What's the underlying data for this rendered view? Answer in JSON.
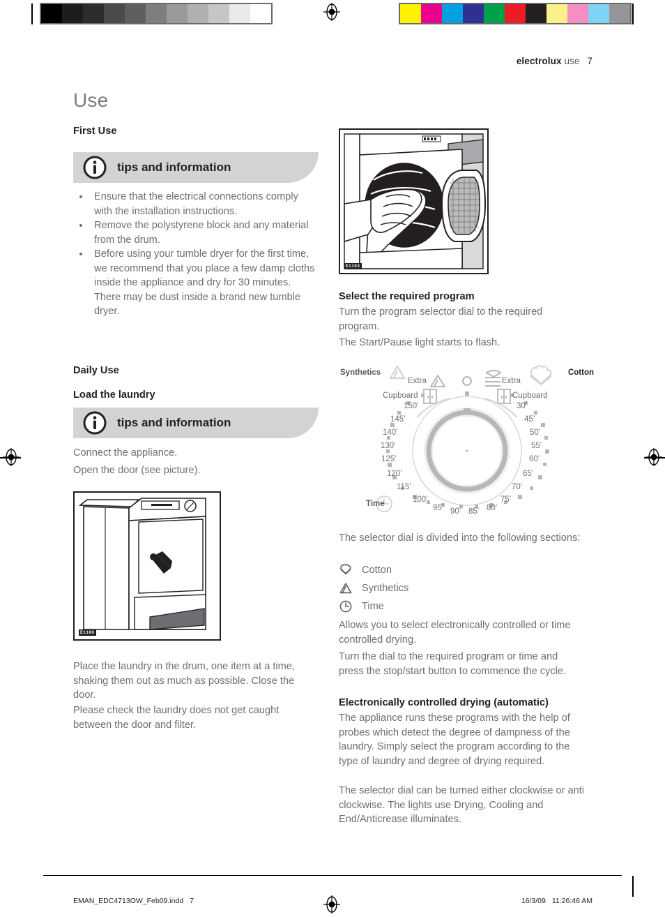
{
  "header": {
    "brand": "electrolux",
    "section": "use",
    "page_number": "7"
  },
  "page_title": "Use",
  "left_column": {
    "first_use_heading": "First Use",
    "tips_banner_label": "tips and information",
    "bullets": [
      "Ensure that the electrical connections comply with the installation instructions.",
      "Remove the polystyrene block and any material from the drum.",
      "Before using your tumble dryer for the first time, we recommend that you place a few damp cloths inside the appliance and dry for 30 minutes."
    ],
    "bullet_continuation": "There may be dust inside a brand new tumble dryer.",
    "daily_use_heading": "Daily Use",
    "load_laundry_heading": "Load the laundry",
    "tips_banner_label_2": "tips and information",
    "connect_line": "Connect the appliance.",
    "open_door_line": "Open the door (see picture).",
    "figure_code": "E1186",
    "closing_paragraph_1": "Place the laundry in the drum, one item at a time, shaking them out as much as possible. Close the door.",
    "closing_paragraph_2": "Please check the laundry does not get caught between the door and filter."
  },
  "right_column": {
    "figure_code": "E1103",
    "select_program_heading": "Select the required program",
    "select_program_line_1": "Turn the program selector dial to the required program.",
    "select_program_line_2": "The Start/Pause light starts to flash.",
    "dial_intro": "The selector dial is divided into the following sections:",
    "legend": [
      {
        "icon": "cotton-icon",
        "label": "Cotton"
      },
      {
        "icon": "synthetics-triangle-icon",
        "label": "Synthetics"
      },
      {
        "icon": "time-clock-icon",
        "label": "Time"
      }
    ],
    "allows_paragraph": "Allows you to select electronically controlled or time controlled drying.",
    "turn_dial_paragraph": "Turn the dial to the required program or time and press the stop/start button to commence the cycle.",
    "auto_heading": "Electronically controlled drying (automatic)",
    "auto_paragraph_1": "The appliance runs these programs with the help of probes which detect the degree of dampness of the laundry. Simply select the program according to the type of laundry and degree of drying required.",
    "auto_paragraph_2": "The selector dial can be turned either clockwise or anti clockwise. The lights use Drying, Cooling and End/Anticrease illuminates."
  },
  "dial": {
    "section_left_label": "Synthetics",
    "section_right_label": "Cotton",
    "time_label": "Time",
    "left_extra_label": "Extra",
    "left_cupboard_label": "Cupboard",
    "right_extra_label": "Extra",
    "right_cupboard_label": "Cupboard",
    "time_ticks_left": [
      "150’",
      "145’",
      "140’",
      "130’",
      "125’",
      "120’",
      "115’",
      "100’"
    ],
    "time_ticks_bottom": [
      "95’",
      "90’",
      "85’",
      "80’"
    ],
    "time_ticks_right": [
      "30’",
      "45’",
      "50’",
      "55’",
      "60’",
      "65’",
      "70’",
      "75’"
    ]
  },
  "footer": {
    "file_name": "EMAN_EDC4713OW_Feb09.indd",
    "page": "7",
    "date": "16/3/09",
    "time": "11:26:46 AM"
  },
  "calibration": {
    "gray_steps": [
      "#000000",
      "#1d1d1d",
      "#2d2d2d",
      "#4a4a4a",
      "#5f5f5f",
      "#7e7e7e",
      "#9a9a9a",
      "#b0b0b0",
      "#c6c6c6",
      "#e9e9e9",
      "#ffffff"
    ],
    "color_patches": [
      "#fff200",
      "#ec008c",
      "#00a0e3",
      "#2e3192",
      "#00a14b",
      "#ed1c24",
      "#231f20",
      "#fbf08a",
      "#f58ec3",
      "#7fd4f5",
      "#939598"
    ]
  }
}
